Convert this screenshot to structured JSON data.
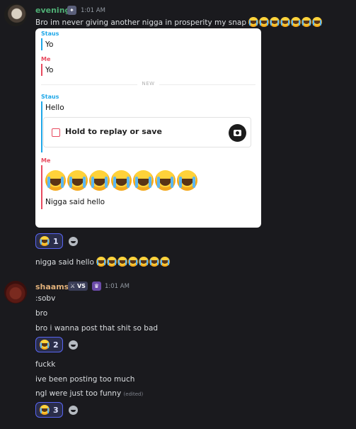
{
  "messages": [
    {
      "author": "evening",
      "time": "1:01 AM",
      "text": "Bro im never giving another nigga in prosperity my snap",
      "emoji": [
        "sob-emoji",
        "sob-emoji",
        "sob-emoji",
        "sob-emoji",
        "sob-emoji",
        "sob-emoji",
        "sob-emoji"
      ],
      "snap_card": {
        "label_staus": "Staus",
        "label_me": "Me",
        "line1": "Yo",
        "line2": "Yo",
        "divider": "NEW",
        "line3": "Hello",
        "replay_prompt": "Hold to replay or save",
        "line4": "Nigga said hello"
      },
      "reaction_count": "1",
      "followup": "nigga said hello"
    },
    {
      "author": "shaams",
      "clan_tag": "VS",
      "time": "1:01 AM",
      "lines": [
        ":sobv",
        "bro",
        "bro i wanna post that shit so bad"
      ],
      "reaction_count": "2",
      "lines2": [
        "fuckk",
        "ive been posting too much",
        "ngl were just too funny"
      ],
      "edited_label": "(edited)",
      "reaction_count2": "3"
    }
  ],
  "colors": {
    "background": "#1a1a1e",
    "evening_name": "#4fae75",
    "shaams_name": "#e0b07a",
    "reaction_border": "#5865f2",
    "snap_blue": "#1ea7e8",
    "snap_red": "#e84a5f"
  }
}
